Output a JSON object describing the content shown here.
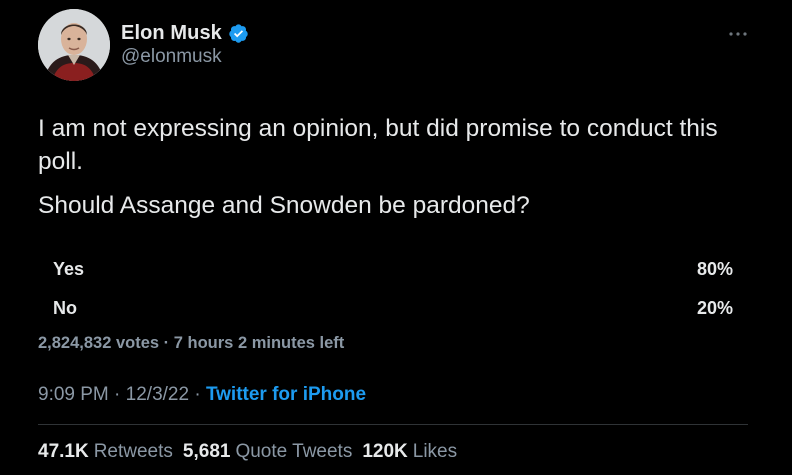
{
  "author": {
    "display_name": "Elon Musk",
    "handle": "@elonmusk",
    "verified": true
  },
  "tweet": {
    "paragraphs": [
      "I am not expressing an opinion, but did promise to conduct this poll.",
      "Should Assange and Snowden be pardoned?"
    ]
  },
  "poll": {
    "options": [
      {
        "label": "Yes",
        "percent_text": "80%",
        "percent": 80
      },
      {
        "label": "No",
        "percent_text": "20%",
        "percent": 20
      }
    ],
    "votes_text": "2,824,832 votes",
    "separator": " · ",
    "time_left": "7 hours 2 minutes left"
  },
  "meta": {
    "time": "9:09 PM",
    "date": "12/3/22",
    "separator": " · ",
    "source": "Twitter for iPhone"
  },
  "stats": {
    "retweets_count": "47.1K",
    "retweets_label": "Retweets",
    "quote_count": "5,681",
    "quote_label": "Quote Tweets",
    "likes_count": "120K",
    "likes_label": "Likes"
  },
  "colors": {
    "background": "#000000",
    "text_primary": "#e7e9ea",
    "text_secondary": "#8b98a5",
    "accent": "#1d9bf0",
    "divider": "#2f3336"
  },
  "icons": {
    "verified": "verified-badge-icon",
    "more": "more-options-icon"
  }
}
